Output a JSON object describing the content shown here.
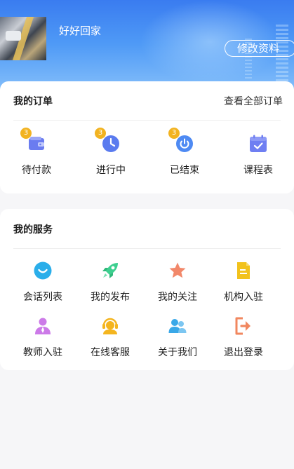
{
  "profile": {
    "username": "好好回家",
    "edit_label": "修改资料"
  },
  "orders": {
    "title": "我的订单",
    "view_all": "查看全部订单",
    "items": [
      {
        "label": "待付款",
        "icon": "wallet-icon",
        "badge": "3",
        "color": "#6a7cf0"
      },
      {
        "label": "进行中",
        "icon": "clock-icon",
        "badge": "3",
        "color": "#5a7bef"
      },
      {
        "label": "已结束",
        "icon": "power-icon",
        "badge": "3",
        "color": "#4e8af3"
      },
      {
        "label": "课程表",
        "icon": "calendar-icon",
        "color": "#6f7ff2"
      }
    ]
  },
  "services": {
    "title": "我的服务",
    "items": [
      {
        "label": "会话列表",
        "icon": "chat-bubble-icon",
        "color": "#2aaeea"
      },
      {
        "label": "我的发布",
        "icon": "rocket-icon",
        "color": "#3dcf8f"
      },
      {
        "label": "我的关注",
        "icon": "star-icon",
        "color": "#f2886a"
      },
      {
        "label": "机构入驻",
        "icon": "document-icon",
        "color": "#f2c21c"
      },
      {
        "label": "教师入驻",
        "icon": "teacher-icon",
        "color": "#cc7ae8"
      },
      {
        "label": "在线客服",
        "icon": "headset-icon",
        "color": "#f4b51f"
      },
      {
        "label": "关于我们",
        "icon": "users-icon",
        "color": "#3aa8e8"
      },
      {
        "label": "退出登录",
        "icon": "logout-icon",
        "color": "#f1875f"
      }
    ]
  }
}
